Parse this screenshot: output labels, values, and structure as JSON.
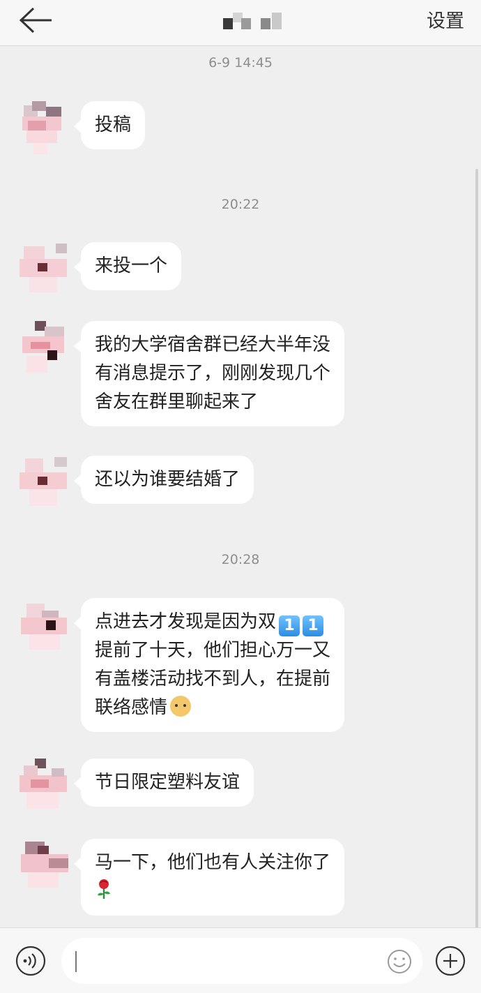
{
  "header": {
    "settings_label": "设置"
  },
  "timestamps": [
    "6-9 14:45",
    "20:22",
    "20:28"
  ],
  "messages": [
    {
      "text": "投稿"
    },
    {
      "text": "来投一个"
    },
    {
      "lines": [
        "我的大学宿舍群已经大半年没",
        "有消息提示了，刚刚发现几个",
        "舍友在群里聊起来了"
      ]
    },
    {
      "text": "还以为谁要结婚了"
    },
    {
      "line1": "点进去才发现是因为双",
      "emoji_digits": [
        "1",
        "1"
      ],
      "line2": "提前了十天，他们担心万一又",
      "line3": "有盖楼活动找不到人，在提前",
      "line4": "联络感情"
    },
    {
      "text": "节日限定塑料友谊"
    },
    {
      "line1": "马一下，他们也有人关注你了"
    }
  ],
  "icons": {
    "back": "back-arrow-icon",
    "voice": "voice-icon",
    "emoji": "smile-icon",
    "more": "plus-icon",
    "doge": "doge-emoji-icon",
    "rose": "rose-emoji-icon"
  },
  "input": {
    "value": ""
  }
}
